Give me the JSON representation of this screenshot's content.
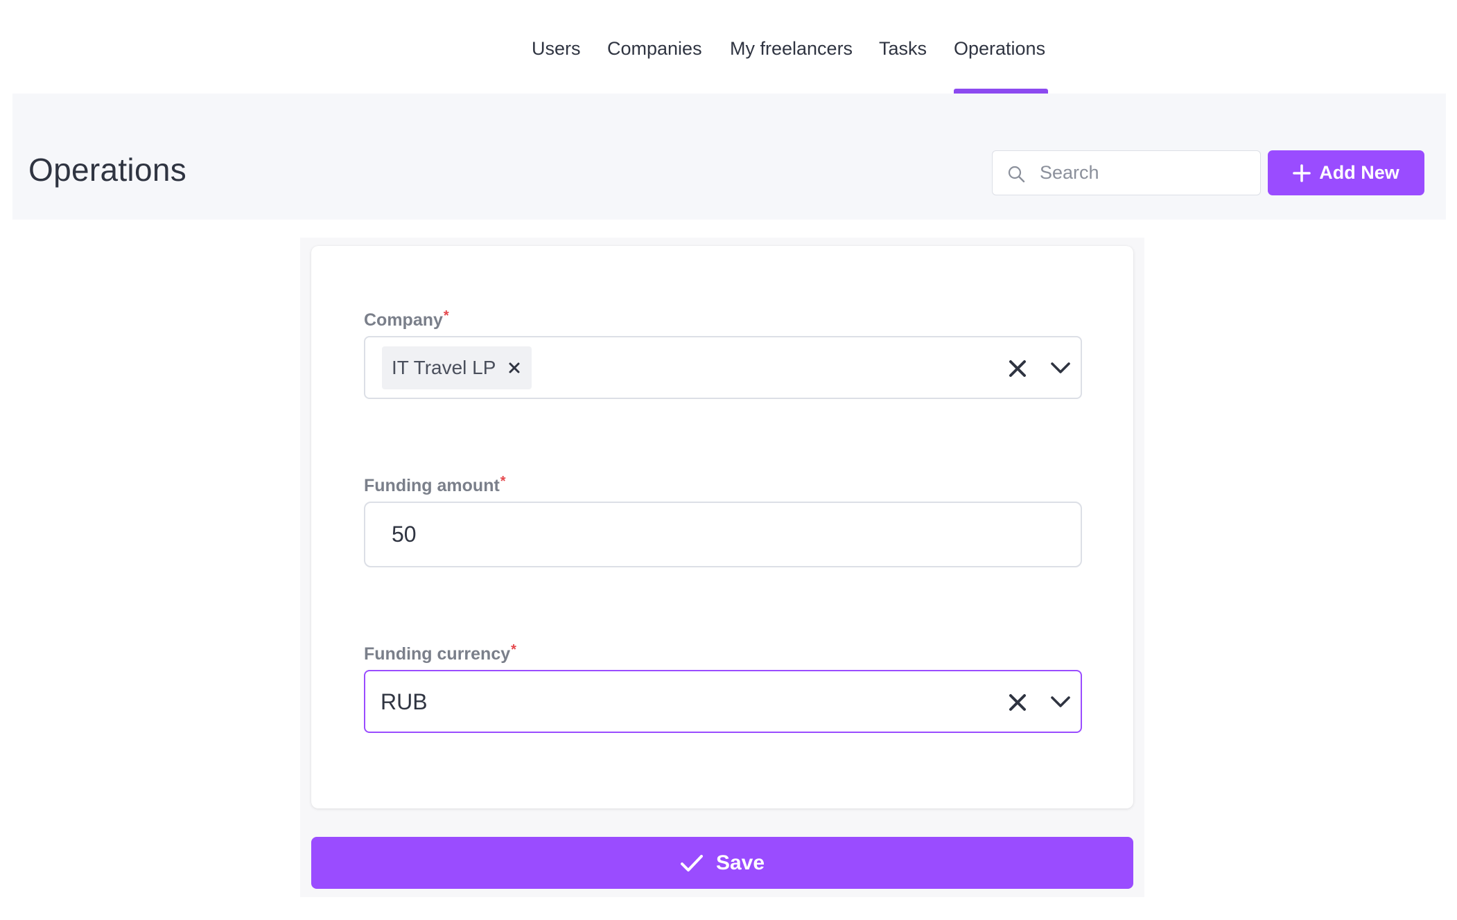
{
  "nav": {
    "tabs": [
      {
        "label": "Users"
      },
      {
        "label": "Companies"
      },
      {
        "label": "My freelancers"
      },
      {
        "label": "Tasks"
      },
      {
        "label": "Operations",
        "active": true
      }
    ]
  },
  "header": {
    "title": "Operations",
    "search_placeholder": "Search",
    "add_new_label": "Add New"
  },
  "form": {
    "company": {
      "label": "Company",
      "required_mark": "*",
      "selected_chip": "IT Travel LP"
    },
    "funding_amount": {
      "label": "Funding amount",
      "required_mark": "*",
      "value": "50"
    },
    "funding_currency": {
      "label": "Funding currency",
      "required_mark": "*",
      "value": "RUB"
    },
    "save_label": "Save"
  },
  "colors": {
    "accent": "#9a4cff",
    "required": "#e5484d",
    "label": "#7a7f8a",
    "text": "#2f3441"
  }
}
